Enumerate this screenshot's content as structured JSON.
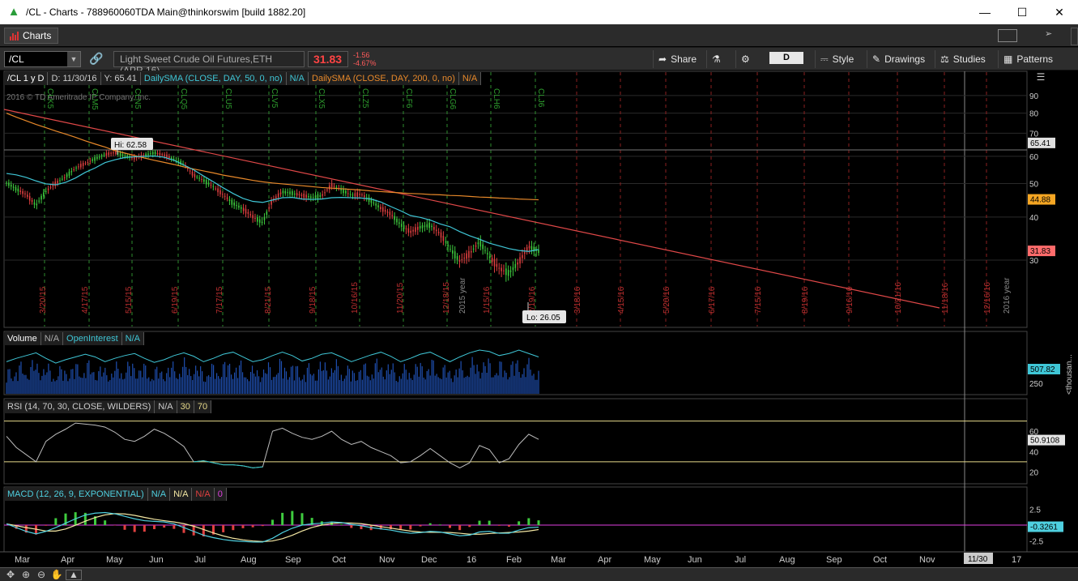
{
  "window": {
    "title": "/CL - Charts - 788960060TDA Main@thinkorswim [build 1882.20]"
  },
  "tab": {
    "label": "Charts"
  },
  "toolbar": {
    "symbol": "/CL",
    "description": "Light Sweet Crude Oil Futures,ETH (APR 16)",
    "last": "31.83",
    "change": "-1.56",
    "change_pct": "-4.67%",
    "share": "Share",
    "period": "D",
    "style": "Style",
    "drawings": "Drawings",
    "studies": "Studies",
    "patterns": "Patterns"
  },
  "price_header": {
    "symbol_period": "/CL 1 y D",
    "d": "D: 11/30/16",
    "y": "Y: 65.41",
    "sma50": "DailySMA (CLOSE, DAY, 50, 0, no)",
    "sma50_val": "N/A",
    "sma200": "DailySMA (CLOSE, DAY, 200, 0, no)",
    "sma200_val": "N/A"
  },
  "volume_header": {
    "label": "Volume",
    "value": "N/A",
    "oi_label": "OpenInterest",
    "oi_value": "N/A"
  },
  "rsi_header": {
    "label": "RSI (14, 70, 30, CLOSE, WILDERS)",
    "value": "N/A",
    "over_sold": "30",
    "over_bought": "70"
  },
  "macd_header": {
    "label": "MACD (12, 26, 9, EXPONENTIAL)",
    "value": "N/A",
    "avg": "N/A",
    "diff": "N/A",
    "zero": "0"
  },
  "copyright": "2016 © TD Ameritrade IP Company, Inc.",
  "callouts": {
    "hi": "Hi: 62.58",
    "lo": "Lo: 26.05"
  },
  "colors": {
    "up": "#3ecb3e",
    "down": "#e04040",
    "sma50": "#3fc6d6",
    "sma200": "#e8892a",
    "trend": "#e04848",
    "rsi": "#bdbdbd",
    "rsi_low": "#2fc7c7",
    "level": "#e6d98a",
    "macd_value": "#4fd0e0",
    "macd_avg": "#f3e7a3",
    "zero_line": "#e040e0"
  },
  "chart_data": {
    "type": "line",
    "xaxis_months": [
      "Mar",
      "Apr",
      "May",
      "Jun",
      "Jul",
      "Aug",
      "Sep",
      "Oct",
      "Nov",
      "Dec",
      "16",
      "Feb",
      "Mar",
      "Apr",
      "May",
      "Jun",
      "Jul",
      "Aug",
      "Sep",
      "Oct",
      "Nov",
      "17"
    ],
    "cursor_date": "11/30",
    "expiry_labels": [
      "CLK5",
      "CLM5",
      "CLN5",
      "CLQ5",
      "CLU5",
      "CLV5",
      "CLX5",
      "CLZ5",
      "CLF6",
      "CLG6",
      "CLH6",
      "CLJ6"
    ],
    "date_labels_past": [
      "3/20/15",
      "4/17/15",
      "5/15/15",
      "6/19/15",
      "7/17/15",
      "8/21/15",
      "9/18/15",
      "10/16/15",
      "11/20/15",
      "12/18/15",
      "1/15/16",
      "2/19/16"
    ],
    "date_labels_future": [
      "3/18/16",
      "4/15/16",
      "5/20/16",
      "6/17/16",
      "7/15/16",
      "8/19/16",
      "9/16/16",
      "10/21/16",
      "11/18/16",
      "12/16/16"
    ],
    "year_labels": [
      "2015 year",
      "2016 year"
    ],
    "price_axis": {
      "ticks": [
        "90",
        "80",
        "70",
        "60",
        "50",
        "40",
        "30"
      ],
      "log_scale": true,
      "range": [
        21,
        97
      ]
    },
    "price_markers": [
      {
        "label": "65.41",
        "value": 65.41
      },
      {
        "label": "44.88",
        "value": 44.88
      },
      {
        "label": "31.83",
        "value": 31.83
      }
    ],
    "series": [
      {
        "name": "/CL",
        "values": [
          50.3,
          48.2,
          46.5,
          43.2,
          47.5,
          50.1,
          52.3,
          55.4,
          57.2,
          59.0,
          60.7,
          61.5,
          60.2,
          59.3,
          60.4,
          61.4,
          60.5,
          58.8,
          56.9,
          52.9,
          51.1,
          49.0,
          46.4,
          43.8,
          42.2,
          40.1,
          38.5,
          44.7,
          47.3,
          46.9,
          46.2,
          45.6,
          46.1,
          49.5,
          48.0,
          46.3,
          46.6,
          44.5,
          42.4,
          40.8,
          38.0,
          36.2,
          37.4,
          37.9,
          35.8,
          32.4,
          29.8,
          31.3,
          33.9,
          30.7,
          28.4,
          27.5,
          29.6,
          32.8,
          31.83
        ]
      },
      {
        "name": "DailySMA 50",
        "values": [
          53.5,
          53.0,
          52.1,
          50.9,
          49.9,
          49.6,
          50.4,
          51.9,
          53.9,
          55.5,
          57.5,
          58.6,
          59.5,
          59.8,
          60.0,
          60.1,
          59.6,
          58.4,
          56.6,
          54.8,
          52.6,
          50.6,
          48.6,
          46.8,
          45.3,
          44.4,
          44.1,
          44.8,
          45.5,
          45.6,
          45.1,
          45.0,
          45.1,
          45.5,
          45.6,
          45.5,
          45.4,
          45.1,
          44.2,
          42.9,
          41.7,
          40.4,
          39.9,
          39.2,
          38.2,
          37.5,
          36.3,
          35.3,
          34.5,
          33.6,
          33.0,
          32.4,
          32.0,
          31.8,
          32.2
        ]
      },
      {
        "name": "DailySMA 200",
        "values": [
          80.0,
          77.9,
          76.0,
          74.2,
          72.6,
          71.0,
          69.6,
          68.1,
          66.5,
          65.1,
          63.8,
          62.3,
          61.3,
          60.3,
          59.3,
          58.4,
          57.6,
          56.8,
          55.9,
          55.1,
          54.4,
          53.7,
          52.9,
          52.3,
          51.7,
          51.1,
          50.6,
          50.2,
          49.9,
          49.6,
          49.3,
          49.0,
          48.7,
          48.5,
          48.3,
          48.1,
          47.9,
          47.6,
          47.4,
          47.2,
          47.0,
          46.8,
          46.7,
          46.5,
          46.4,
          46.2,
          46.1,
          45.9,
          45.7,
          45.6,
          45.4,
          45.3,
          45.1,
          45.0,
          44.88
        ]
      },
      {
        "name": "Volume",
        "values": [
          470,
          520,
          560,
          600,
          520,
          450,
          500,
          540,
          580,
          540,
          470,
          520,
          560,
          590,
          520,
          460,
          500,
          560,
          600,
          550,
          470,
          520,
          580,
          610,
          540,
          470,
          500,
          560,
          610,
          560,
          480,
          520,
          580,
          600,
          540,
          470,
          520,
          570,
          610,
          550,
          470,
          520,
          580,
          610,
          540,
          470,
          540,
          600,
          640,
          620,
          560,
          590,
          640,
          590,
          540
        ]
      },
      {
        "name": "RSI",
        "values": [
          55,
          44,
          37,
          30,
          50,
          57,
          62,
          68,
          67,
          66,
          64,
          59,
          52,
          50,
          55,
          62,
          58,
          52,
          45,
          30,
          31,
          29,
          27,
          27,
          26,
          24,
          25,
          60,
          63,
          58,
          54,
          52,
          55,
          60,
          52,
          47,
          50,
          44,
          40,
          36,
          29,
          30,
          36,
          43,
          36,
          29,
          24,
          29,
          46,
          42,
          29,
          33,
          47,
          57,
          52
        ]
      },
      {
        "name": "MACD",
        "values": [
          0.2,
          -0.4,
          -1.0,
          -1.4,
          -1.0,
          -0.4,
          0.3,
          1.0,
          1.6,
          1.9,
          2.0,
          1.8,
          1.4,
          1.0,
          0.7,
          0.6,
          0.5,
          0.2,
          -0.4,
          -1.0,
          -1.6,
          -2.0,
          -2.3,
          -2.5,
          -2.6,
          -2.7,
          -2.7,
          -2.1,
          -1.2,
          -0.5,
          0.0,
          0.2,
          0.3,
          0.5,
          0.4,
          0.1,
          -0.1,
          -0.4,
          -0.6,
          -0.8,
          -1.1,
          -1.3,
          -1.2,
          -1.0,
          -1.1,
          -1.4,
          -1.7,
          -1.6,
          -1.1,
          -1.0,
          -1.3,
          -1.3,
          -0.8,
          -0.4,
          -0.33
        ]
      }
    ],
    "volume_axis": {
      "ticks": [
        "250"
      ],
      "marker": "507.82",
      "marker_value": 507.82,
      "unit": "<thousan..."
    },
    "rsi_axis": {
      "ticks": [
        "60",
        "40",
        "20"
      ],
      "levels": [
        70,
        30
      ],
      "range": [
        10,
        80
      ],
      "marker": "50.9108",
      "marker_value": 50.9108
    },
    "macd_axis": {
      "ticks": [
        "2.5",
        "-2.5"
      ],
      "marker": "-0.3261",
      "marker_value": -0.3261,
      "range": [
        -4,
        4
      ]
    }
  }
}
